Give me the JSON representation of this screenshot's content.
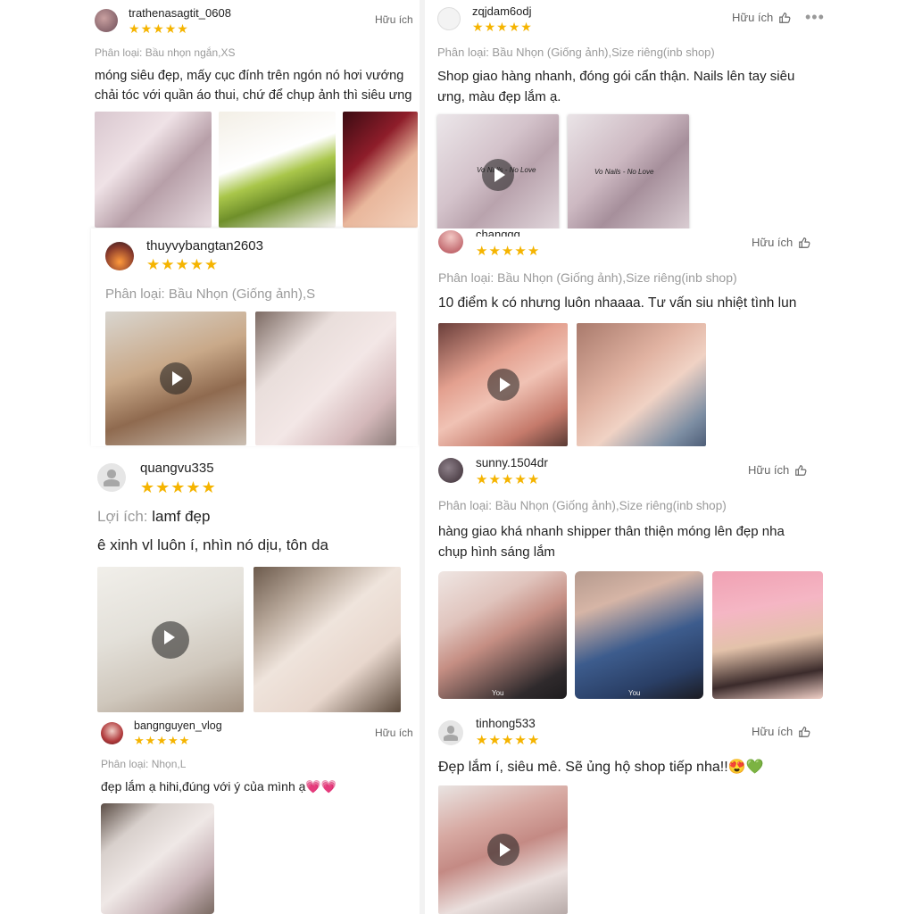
{
  "helpful_label": "Hữu ích",
  "more_label": "•••",
  "reviews": [
    {
      "user": "trathenasagtit_0608",
      "variant": "Phân loại: Bầu nhọn ngắn,XS",
      "line1": "móng siêu đẹp, mấy cục đính trên ngón nó hơi vướng",
      "line2": "chải tóc với quần áo thui, chứ để chụp ảnh thì siêu ưng"
    },
    {
      "user": "zqjdam6odj",
      "variant": "Phân loại: Bầu Nhọn (Giống ảnh),Size riêng(inb shop)",
      "line1": "Shop giao hàng nhanh, đóng gói cẩn thận. Nails lên tay siêu",
      "line2": "ưng, màu đẹp lắm ạ.",
      "photo_caption": "Vo Nails - No Love"
    },
    {
      "user": "thuyvybangtan2603",
      "variant": "Phân loại: Bầu Nhọn (Giống ảnh),S"
    },
    {
      "user": "changgg",
      "variant": "Phân loại: Bầu Nhọn (Giống ảnh),Size riêng(inb shop)",
      "line1": "10 điểm k có nhưng luôn nhaaaa. Tư vấn siu nhiệt tình lun"
    },
    {
      "user": "quangvu335",
      "benefit_label": "Lợi ích:",
      "benefit_value": "lamf đẹp",
      "line1": "ê xinh vl luôn í, nhìn nó dịu, tôn da"
    },
    {
      "user": "sunny.1504dr",
      "variant": "Phân loại: Bầu Nhọn (Giống ảnh),Size riêng(inb shop)",
      "line1": "hàng giao khá nhanh shipper thân thiện móng lên đẹp nha",
      "line2": "chụp hình sáng lắm",
      "photo_label": "You"
    },
    {
      "user": "bangnguyen_vlog",
      "variant": "Phân loại: Nhọn,L",
      "line1": "đẹp lắm ạ hihi,đúng với ý của mình ạ💗💗"
    },
    {
      "user": "tinhong533",
      "line1": "Đẹp lắm í, siêu mê. Sẽ ủng hộ shop tiếp nha!!😍💚"
    }
  ],
  "colors": {
    "star": "#f5b400",
    "variant_text": "#9a9a9a",
    "body_text": "#222222"
  }
}
